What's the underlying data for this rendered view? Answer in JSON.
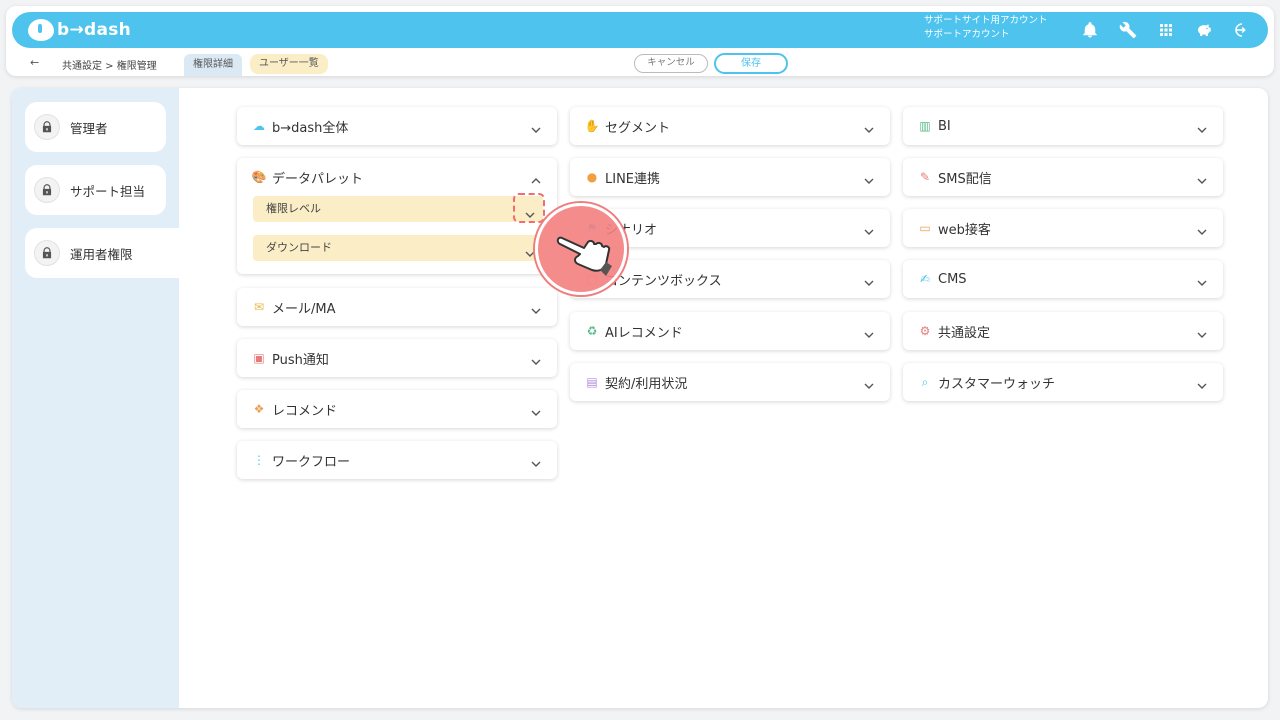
{
  "app": {
    "name": "b→dash"
  },
  "header": {
    "account_line1": "サポートサイト用アカウント",
    "account_line2": "サポートアカウント",
    "icons": [
      "bell-icon",
      "wrench-icon",
      "grid-icon",
      "piggy-icon",
      "logout-icon"
    ]
  },
  "subbar": {
    "back": "←",
    "breadcrumb": "共通設定 > 権限管理",
    "tab_detail": "権限詳細",
    "tab_users": "ユーザー一覧",
    "cancel": "キャンセル",
    "save": "保存"
  },
  "sidebar": {
    "items": [
      {
        "label": "管理者"
      },
      {
        "label": "サポート担当"
      },
      {
        "label": "運用者権限"
      }
    ]
  },
  "col1": [
    {
      "label": "b→dash全体",
      "icon": "cloud-icon"
    },
    {
      "label": "データパレット",
      "icon": "palette-icon"
    },
    {
      "label": "メール/MA",
      "icon": "mail-icon"
    },
    {
      "label": "Push通知",
      "icon": "push-icon"
    },
    {
      "label": "レコメンド",
      "icon": "recommend-icon"
    },
    {
      "label": "ワークフロー",
      "icon": "workflow-icon"
    }
  ],
  "datapalette_subs": [
    {
      "label": "権限レベル"
    },
    {
      "label": "ダウンロード"
    }
  ],
  "col2": [
    {
      "label": "セグメント",
      "icon": "hand-icon"
    },
    {
      "label": "LINE連携",
      "icon": "line-icon"
    },
    {
      "label": "シナリオ",
      "icon": "scenario-icon"
    },
    {
      "label": "コンテンツボックス",
      "icon": "box-icon"
    },
    {
      "label": "AIレコメンド",
      "icon": "ai-icon"
    },
    {
      "label": "契約/利用状況",
      "icon": "contract-icon"
    }
  ],
  "col3": [
    {
      "label": "BI",
      "icon": "chart-icon"
    },
    {
      "label": "SMS配信",
      "icon": "sms-icon"
    },
    {
      "label": "web接客",
      "icon": "web-icon"
    },
    {
      "label": "CMS",
      "icon": "cms-icon"
    },
    {
      "label": "共通設定",
      "icon": "settings-icon"
    },
    {
      "label": "カスタマーウォッチ",
      "icon": "magnifier-icon"
    }
  ]
}
